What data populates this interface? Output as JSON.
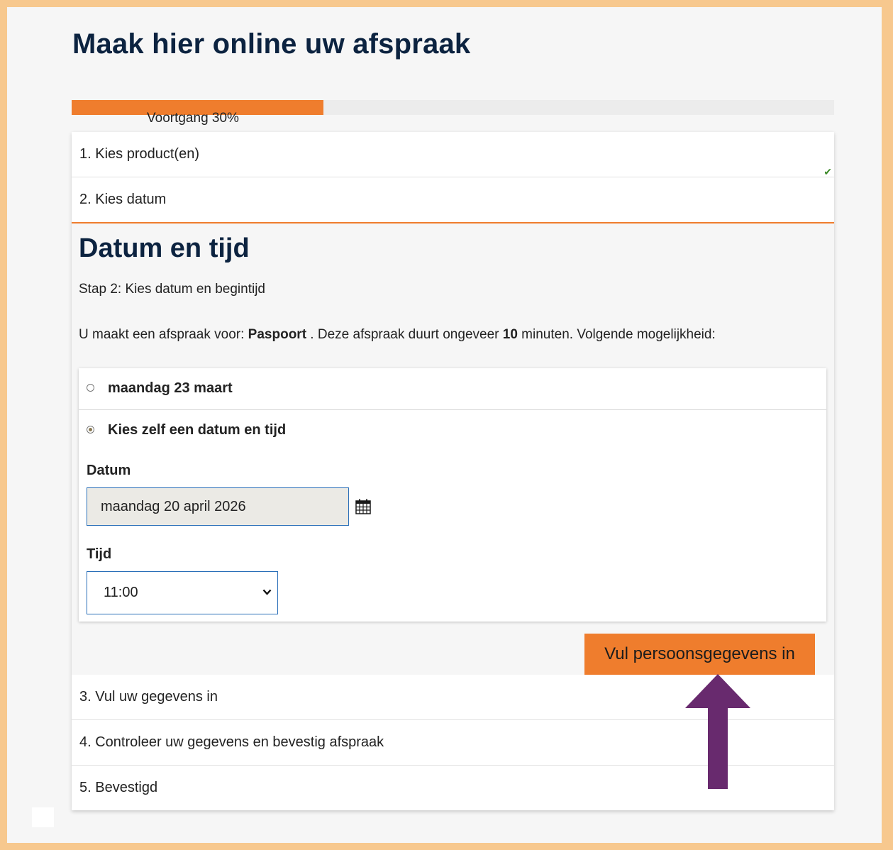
{
  "page": {
    "title": "Maak hier online uw afspraak"
  },
  "progress": {
    "label": "Voortgang 30%",
    "percent": 33,
    "color": "#ef7d2d"
  },
  "steps": [
    {
      "label": "1. Kies product(en)",
      "done": true
    },
    {
      "label": "2. Kies datum",
      "current": true
    },
    {
      "label": "3. Vul uw gegevens in"
    },
    {
      "label": "4. Controleer uw gegevens en bevestig afspraak"
    },
    {
      "label": "5. Bevestigd"
    }
  ],
  "panel": {
    "heading": "Datum en tijd",
    "subtitle": "Stap 2: Kies datum en begintijd",
    "info": {
      "prefix": "U maakt een afspraak voor: ",
      "product": "Paspoort",
      "middle": " . Deze afspraak duurt ongeveer ",
      "duration": "10",
      "suffix": " minuten. Volgende mogelijkheid:"
    },
    "options": [
      {
        "label": "maandag 23 maart",
        "selected": false
      },
      {
        "label": "Kies zelf een datum en tijd",
        "selected": true
      }
    ],
    "date": {
      "label": "Datum",
      "value": "maandag 20 april 2026",
      "icon": "calendar-icon"
    },
    "time": {
      "label": "Tijd",
      "value": "11:00",
      "icon": "chevron-down-icon"
    },
    "next_button": "Vul persoonsgegevens in"
  },
  "annotation": {
    "icon": "arrow-up-icon",
    "color": "#682a6e"
  },
  "colors": {
    "accent": "#ef7d2d",
    "heading": "#0c2340",
    "frame": "#f7c88e",
    "check": "#3c8a28"
  }
}
